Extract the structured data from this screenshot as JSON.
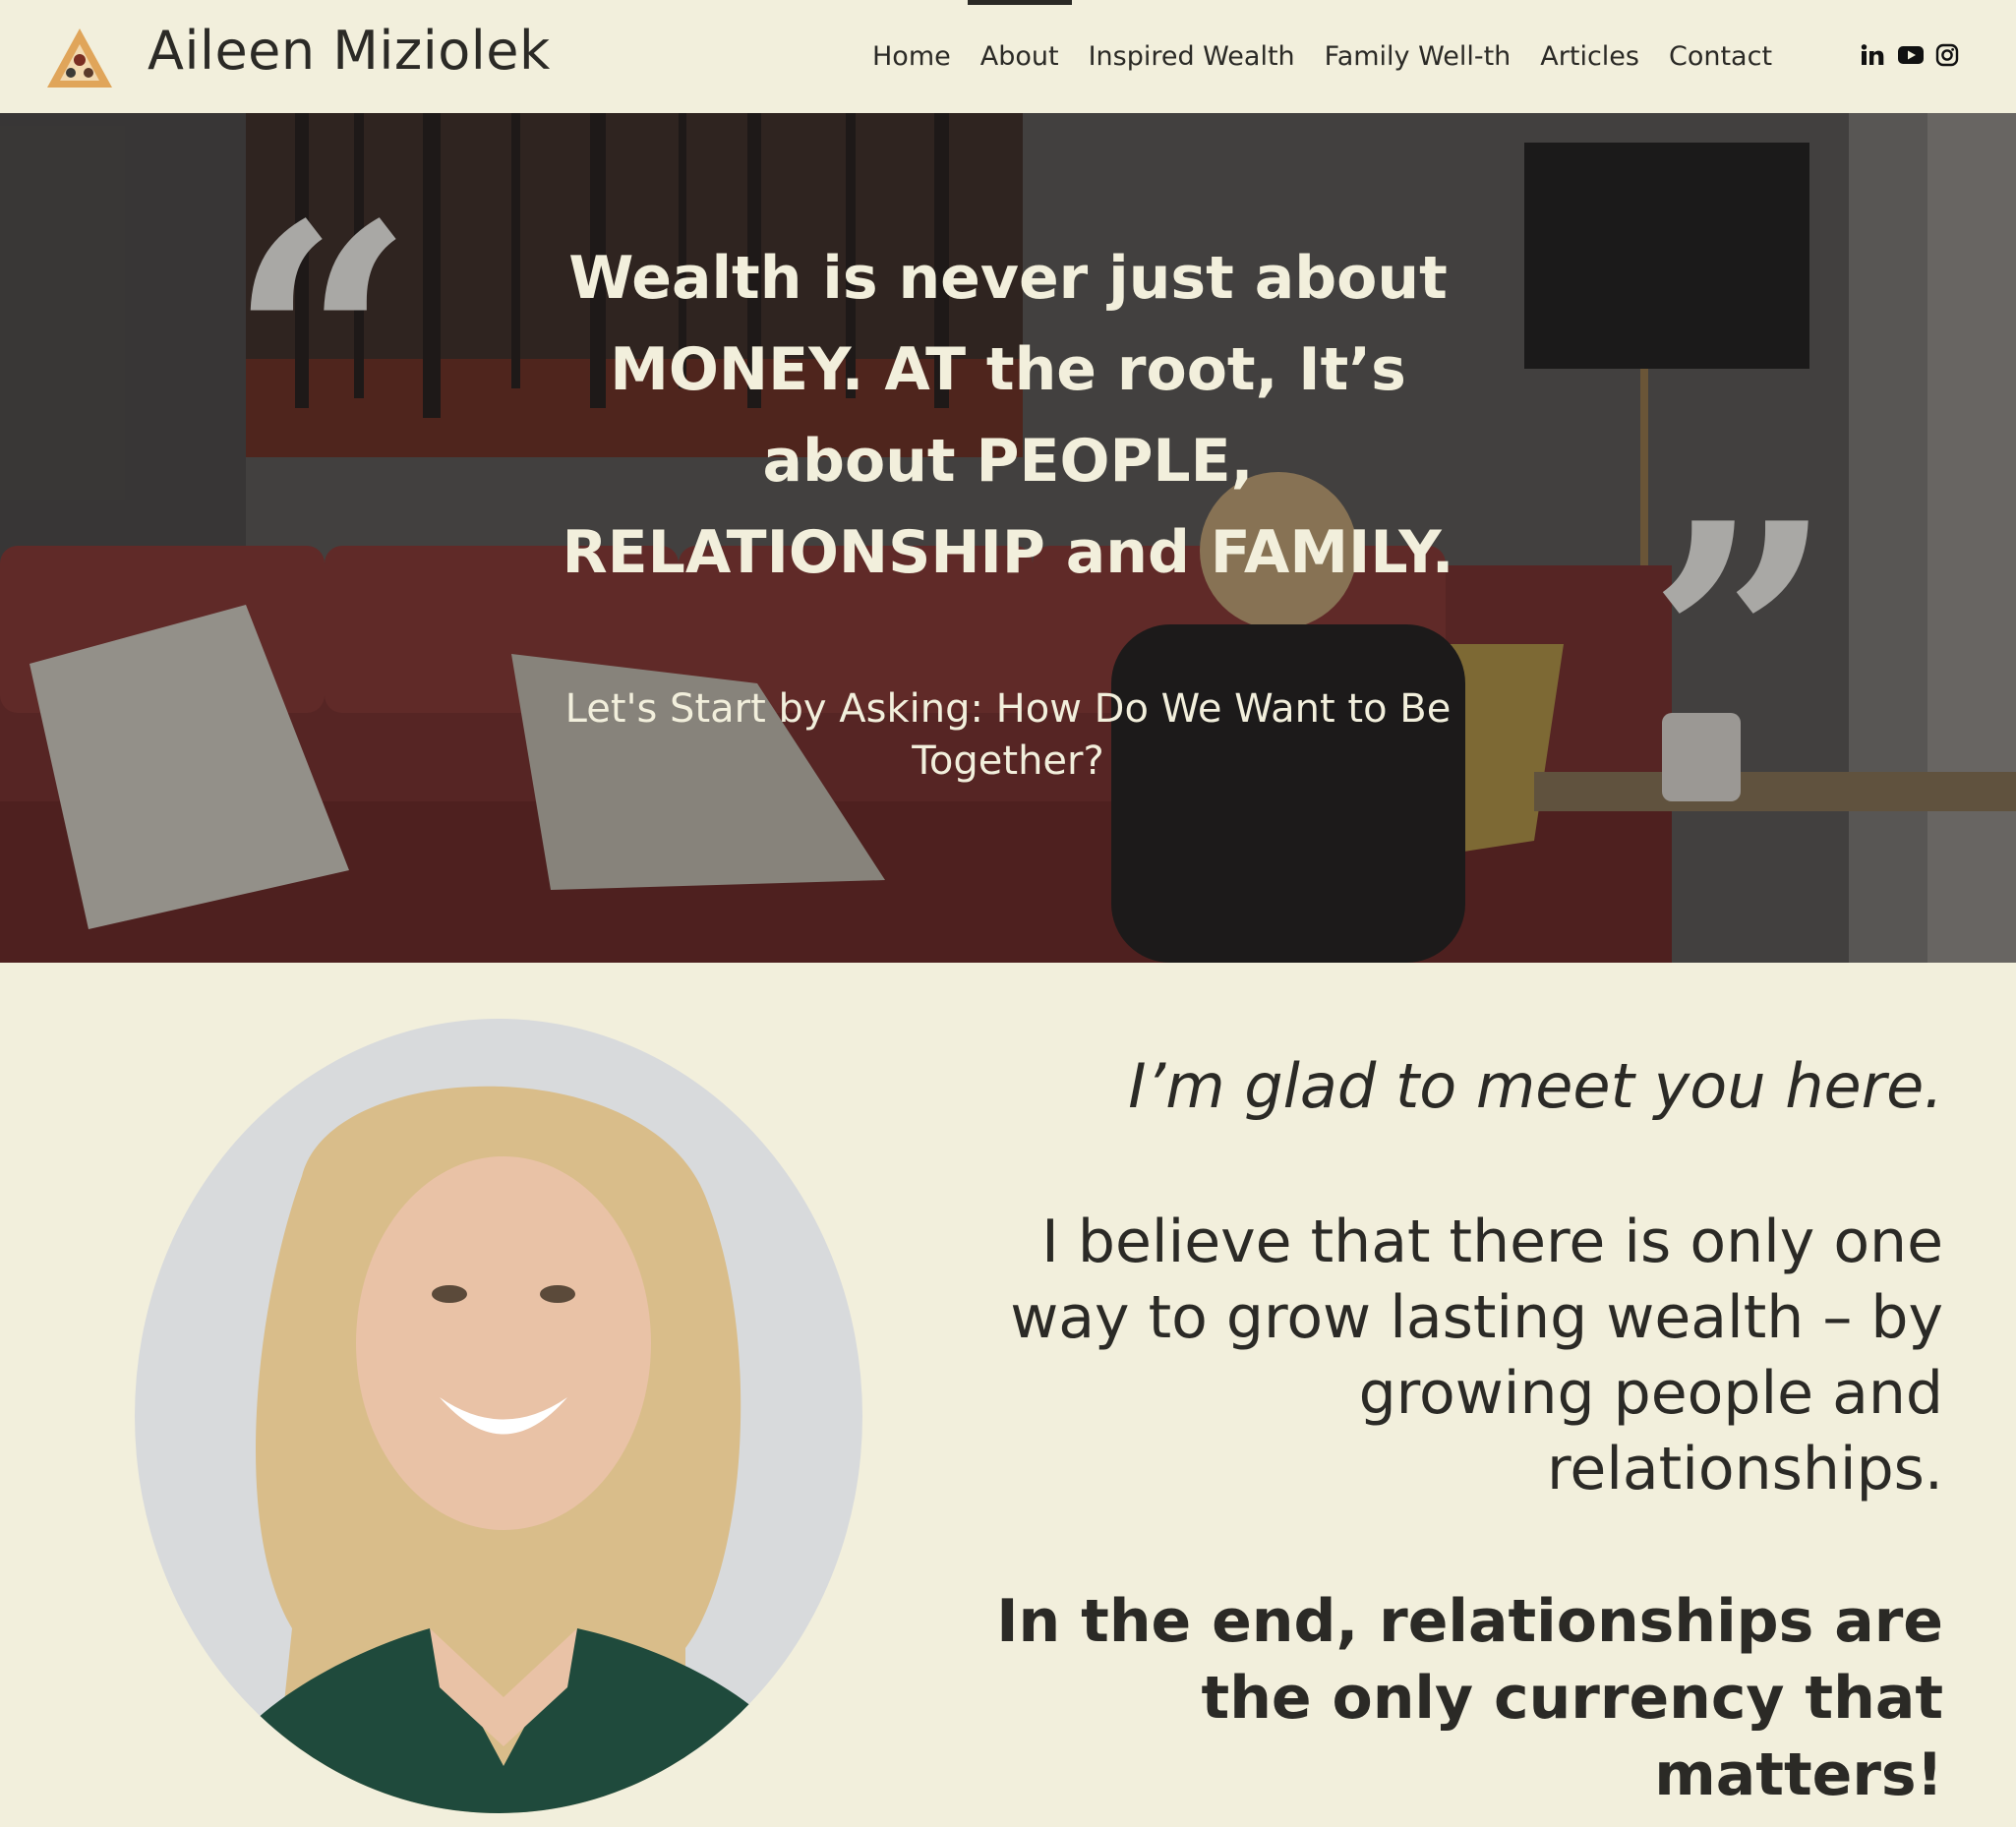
{
  "header": {
    "brand": "Aileen Miziolek",
    "logo_icon": "triangle-logo-icon",
    "nav": [
      {
        "label": "Home",
        "active": false
      },
      {
        "label": "About",
        "active": true
      },
      {
        "label": "Inspired Wealth",
        "active": false
      },
      {
        "label": "Family Well-th",
        "active": false
      },
      {
        "label": "Articles",
        "active": false
      },
      {
        "label": "Contact",
        "active": false
      }
    ],
    "social": [
      "linkedin-icon",
      "youtube-icon",
      "instagram-icon"
    ]
  },
  "hero": {
    "quote_open": "“",
    "quote_close": "”",
    "title": "Wealth is never just about MONEY. AT the root, It’s about PEOPLE, RELATIONSHIP and FAMILY.",
    "subtitle": "Let's Start by Asking: How Do We Want to Be Together?"
  },
  "about": {
    "greeting": "I’m glad to meet you here.",
    "belief": "I believe that there is only one way to grow lasting wealth – by growing people and relationships.",
    "closing": "In the end, relationships are the only currency that matters!"
  },
  "colors": {
    "background": "#f2efdc",
    "text": "#2b2a26",
    "hero_text": "#f2efdc",
    "logo_orange": "#e0a55a"
  }
}
